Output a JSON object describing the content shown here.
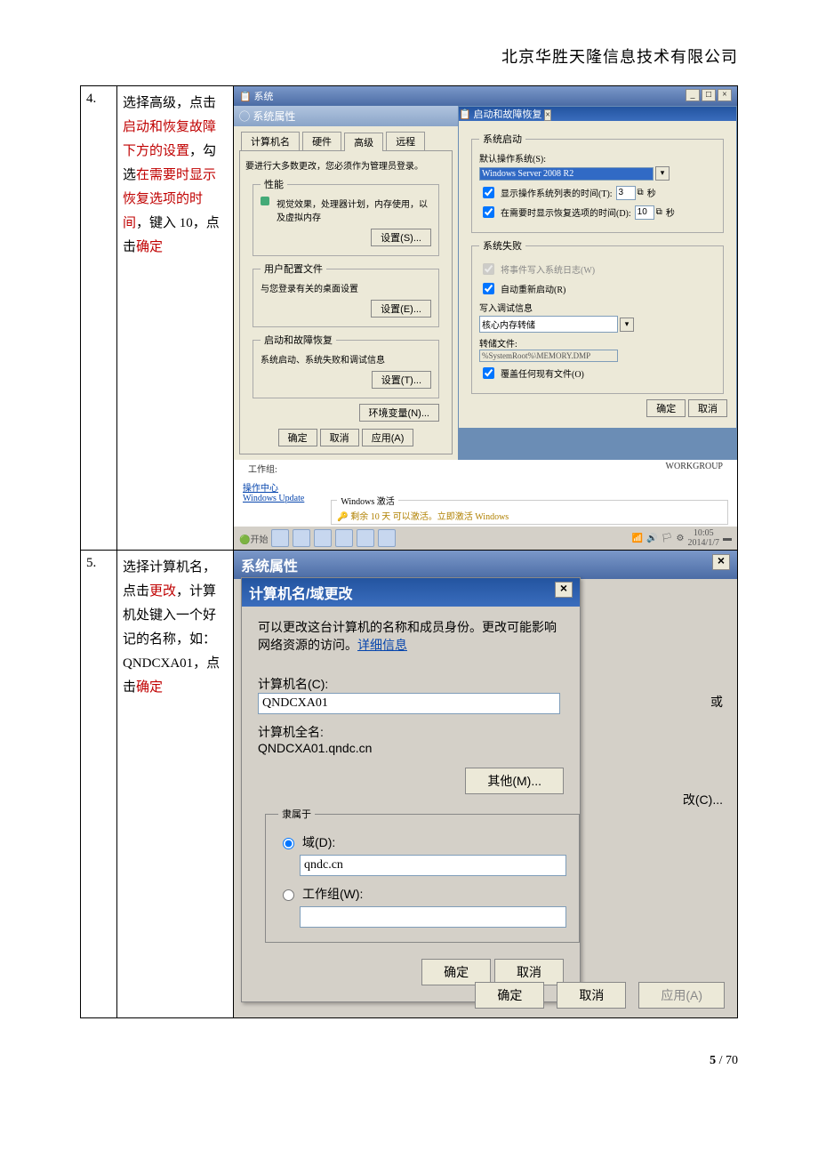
{
  "header": {
    "company": "北京华胜天隆信息技术有限公司"
  },
  "footer": {
    "current": "5",
    "sep": " / ",
    "total": "70"
  },
  "step4": {
    "num": "4.",
    "instr_plain1": "选择高级，点击",
    "instr_red1": "启动和恢复故障下方的设置",
    "instr_plain2": "，勾选",
    "instr_red2": "在需要时显示恢复选项的时间",
    "instr_plain3": "，键入 10，点击",
    "instr_red3": "确定",
    "shot": {
      "outer_title": "系统",
      "sys_props_title": "系统属性",
      "tabs": {
        "t1": "计算机名",
        "t2": "硬件",
        "t3": "高级",
        "t4": "远程"
      },
      "admin_note": "要进行大多数更改，您必须作为管理员登录。",
      "perf_legend": "性能",
      "perf_desc": "视觉效果，处理器计划，内存使用，以及虚拟内存",
      "perf_btn": "设置(S)...",
      "userprof_legend": "用户配置文件",
      "userprof_desc": "与您登录有关的桌面设置",
      "userprof_btn": "设置(E)...",
      "startup_legend": "启动和故障恢复",
      "startup_desc": "系统启动、系统失败和调试信息",
      "startup_btn": "设置(T)...",
      "env_btn": "环境变量(N)...",
      "ok": "确定",
      "cancel": "取消",
      "apply": "应用(A)",
      "sr_title": "启动和故障恢复",
      "sr_boot_legend": "系统启动",
      "sr_default_os": "默认操作系统(S):",
      "sr_os_value": "Windows Server 2008 R2",
      "sr_cb1": "显示操作系统列表的时间(T):",
      "sr_cb1_val": "3",
      "sr_sec": "秒",
      "sr_cb2": "在需要时显示恢复选项的时间(D):",
      "sr_cb2_val": "10",
      "sr_fail_legend": "系统失败",
      "sr_cb3": "将事件写入系统日志(W)",
      "sr_cb4": "自动重新启动(R)",
      "sr_write_label": "写入调试信息",
      "sr_dump_sel": "核心内存转储",
      "sr_dump_label": "转储文件:",
      "sr_dump_path": "%SystemRoot%\\MEMORY.DMP",
      "sr_cb5": "覆盖任何现有文件(O)",
      "sr_ok": "确定",
      "sr_cancel": "取消",
      "below_line": "WORKGROUP",
      "below_workgroup_lbl": "工作组:",
      "link1": "操作中心",
      "link2": "Windows Update",
      "activate_legend": "Windows 激活",
      "activate_text": "剩余 10 天 可以激活。立即激活 Windows",
      "taskbar_start": "开始",
      "taskbar_time": "10:05",
      "taskbar_date": "2014/1/7"
    }
  },
  "step5": {
    "num": "5.",
    "instr_p1": "选择计算机名，点击",
    "instr_red1": "更改",
    "instr_p2": "，计算机处键入一个好记的名称，如：QNDCXA01，点击",
    "instr_red2": "确定",
    "sys_title": "系统属性",
    "inner_title": "计算机名/域更改",
    "desc1": "可以更改这台计算机的名称和成员身份。更改可能影响网络资源的访问。",
    "desc_link": "详细信息",
    "cname_label": "计算机名(C):",
    "cname_value": "QNDCXA01",
    "full_label": "计算机全名:",
    "full_value": "QNDCXA01.qndc.cn",
    "more_btn": "其他(M)...",
    "member_legend": "隶属于",
    "domain_radio": "域(D):",
    "domain_value": "qndc.cn",
    "workgroup_radio": "工作组(W):",
    "workgroup_value": "",
    "ok": "确定",
    "cancel": "取消",
    "side_huo": "或",
    "side_change": "改(C)...",
    "outer_ok": "确定",
    "outer_cancel": "取消",
    "outer_apply": "应用(A)"
  }
}
